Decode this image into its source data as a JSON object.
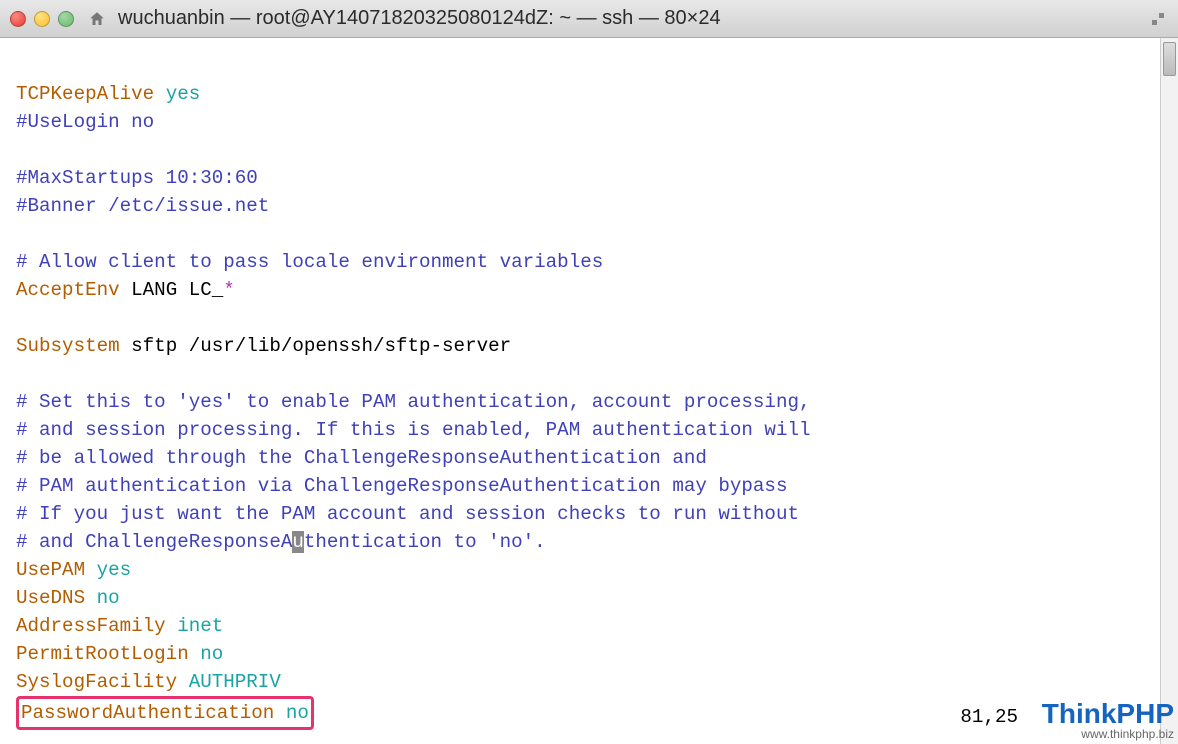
{
  "window": {
    "title": "wuchuanbin — root@AY14071820325080124dZ: ~ — ssh — 80×24"
  },
  "lines": {
    "l1a": "TCPKeepAlive",
    "l1b": " yes",
    "l2": "#UseLogin no",
    "l4": "#MaxStartups 10:30:60",
    "l5": "#Banner /etc/issue.net",
    "l7": "# Allow client to pass locale environment variables",
    "l8a": "AcceptEnv",
    "l8b": " LANG LC_",
    "l8c": "*",
    "l10a": "Subsystem",
    "l10b": " sftp /usr/lib/openssh/sftp-server",
    "l12": "# Set this to 'yes' to enable PAM authentication, account processing,",
    "l13": "# and session processing. If this is enabled, PAM authentication will",
    "l14": "# be allowed through the ChallengeResponseAuthentication and",
    "l15": "# PAM authentication via ChallengeResponseAuthentication may bypass",
    "l16": "# If you just want the PAM account and session checks to run without",
    "l17a": "# and ChallengeResponseA",
    "l17cur": "u",
    "l17b": "thentication to 'no'.",
    "l18a": "UsePAM",
    "l18b": " yes",
    "l19a": "UseDNS",
    "l19b": " no",
    "l20a": "AddressFamily",
    "l20b": " inet",
    "l21a": "PermitRootLogin",
    "l21b": " no",
    "l22a": "SyslogFacility",
    "l22b": " AUTHPRIV",
    "l23a": "PasswordAuthentication",
    "l23b": " no"
  },
  "status": {
    "pos": "81,25"
  },
  "watermark": {
    "big1": "Think",
    "big2": "PHP",
    "url": "www.thinkphp.biz"
  }
}
